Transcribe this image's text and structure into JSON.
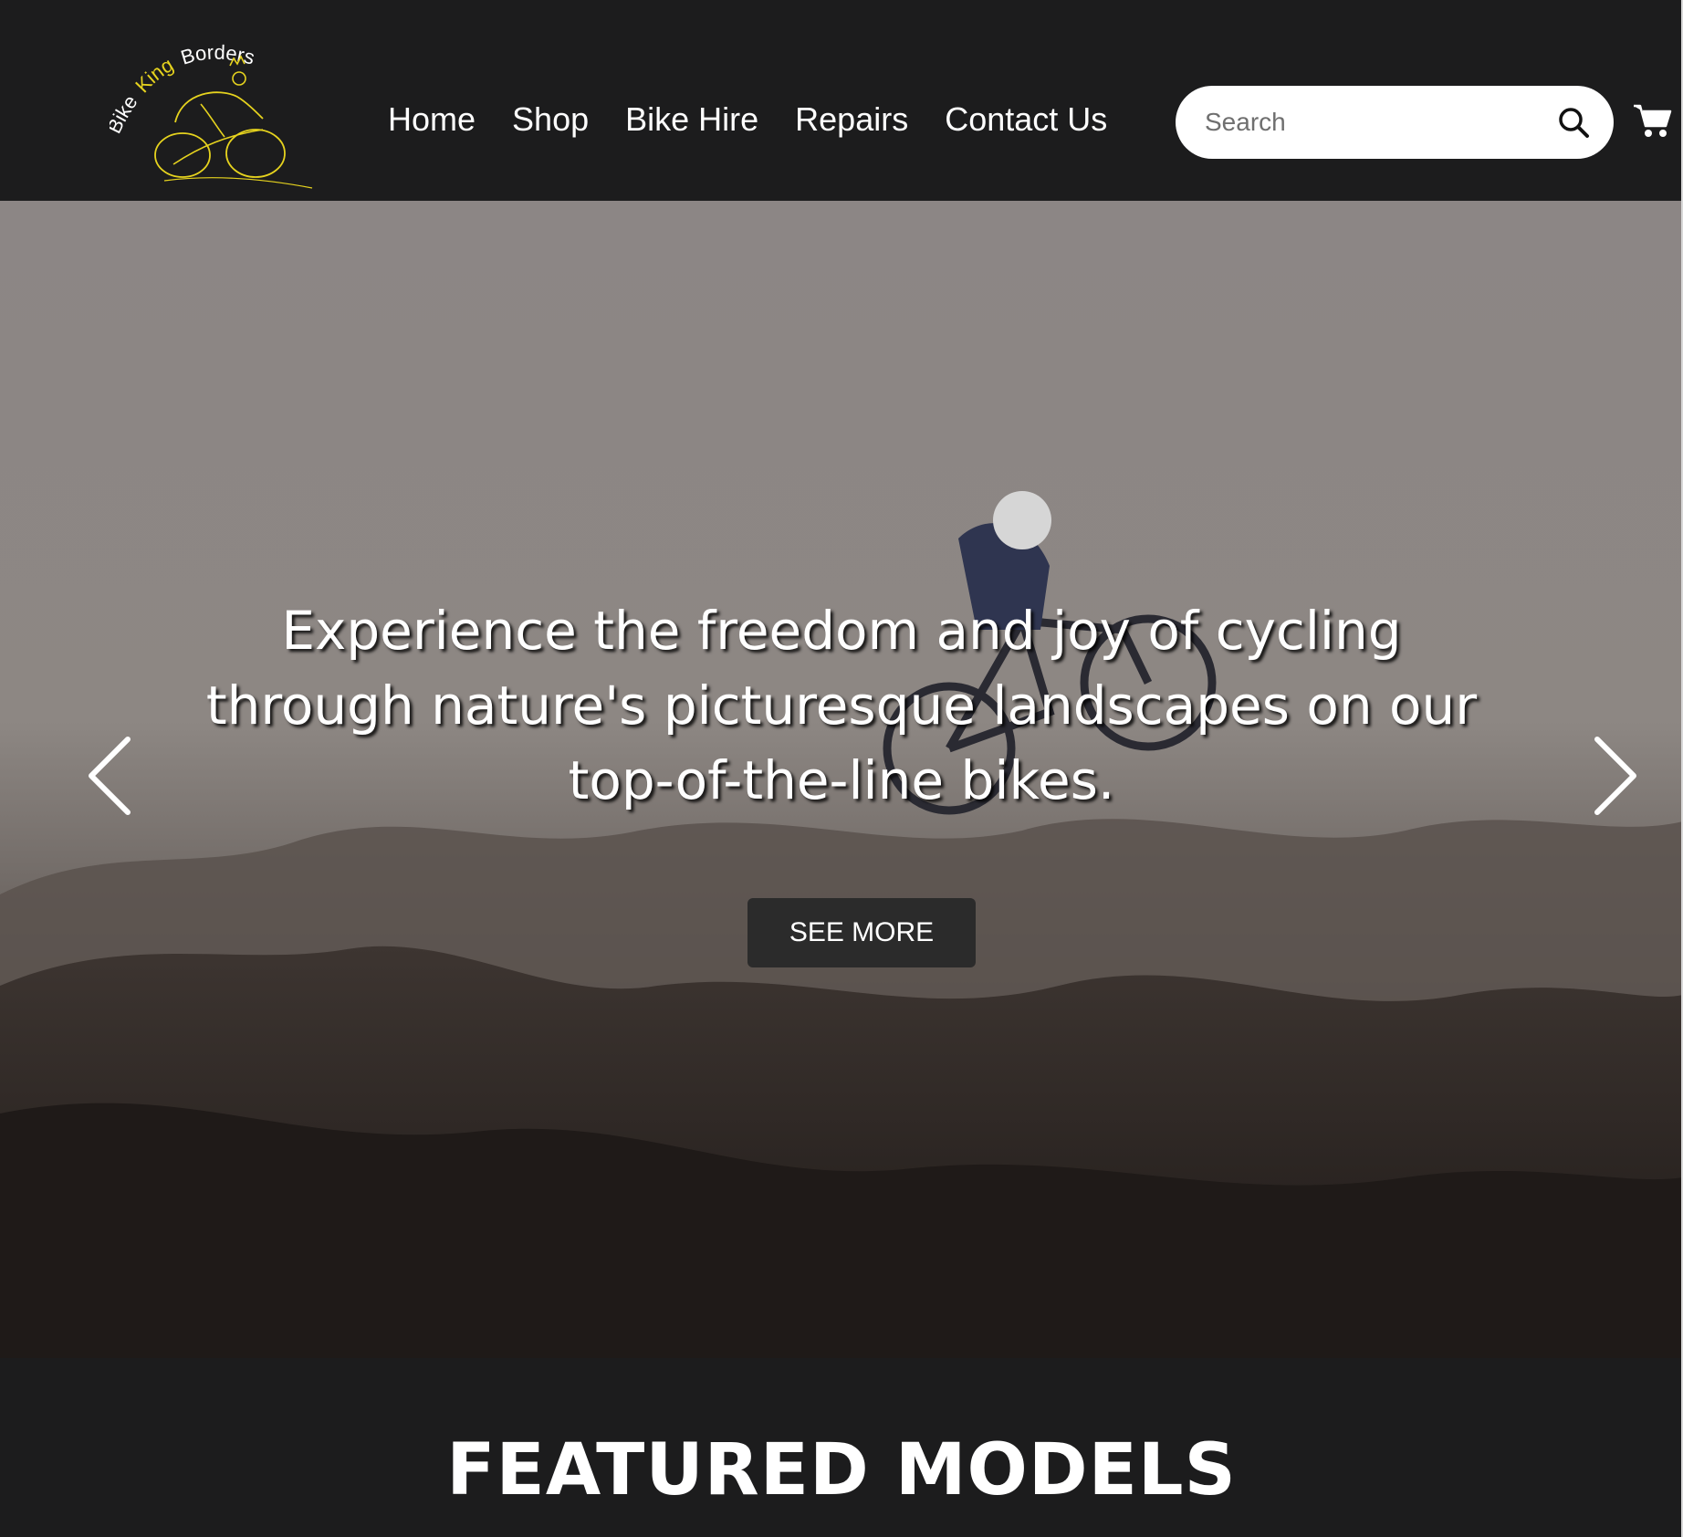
{
  "brand": {
    "word_1": "Bike",
    "word_2": "King",
    "word_3": "Borders",
    "accent_color": "#e6d31e"
  },
  "nav": {
    "items": [
      {
        "label": "Home"
      },
      {
        "label": "Shop"
      },
      {
        "label": "Bike Hire"
      },
      {
        "label": "Repairs"
      },
      {
        "label": "Contact Us"
      }
    ]
  },
  "search": {
    "placeholder": "Search",
    "value": "",
    "icon": "search-icon"
  },
  "cart": {
    "icon": "cart-icon"
  },
  "hero": {
    "headline": "Experience the freedom and joy of cycling through nature's picturesque landscapes on our top-of-the-line bikes.",
    "cta_label": "SEE MORE",
    "prev_icon": "chevron-left-icon",
    "next_icon": "chevron-right-icon"
  },
  "featured": {
    "title": "FEATURED MODELS"
  },
  "colors": {
    "background": "#1c1c1d",
    "text": "#ffffff",
    "button_bg": "#2b2b2b"
  }
}
